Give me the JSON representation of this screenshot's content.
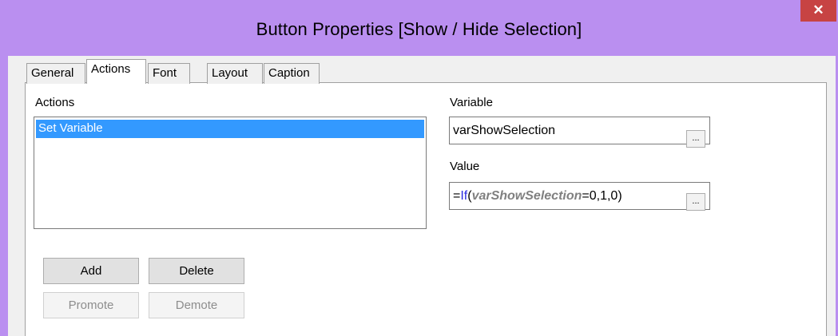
{
  "window": {
    "title": "Button Properties [Show / Hide Selection]",
    "close_glyph": "✕"
  },
  "tabs": [
    {
      "label": "General",
      "active": false
    },
    {
      "label": "Actions",
      "active": true
    },
    {
      "label": "Font",
      "active": false
    },
    {
      "label": "Layout",
      "active": false
    },
    {
      "label": "Caption",
      "active": false
    }
  ],
  "actions": {
    "label": "Actions",
    "items": [
      "Set Variable"
    ],
    "selected": "Set Variable"
  },
  "variable": {
    "label": "Variable",
    "value": "varShowSelection",
    "browse_label": "..."
  },
  "value": {
    "label": "Value",
    "expr_prefix": "=",
    "expr_function": "If",
    "expr_open": "(",
    "expr_variable": "varShowSelection",
    "expr_rest": "=0,1,0)",
    "browse_label": "..."
  },
  "buttons": {
    "add": "Add",
    "delete": "Delete",
    "promote": "Promote",
    "demote": "Demote"
  },
  "colors": {
    "frame": "#ba8ff0",
    "close": "#c74343",
    "selection": "#3399ff",
    "function_text": "#2a2ae0",
    "variable_text": "#808080"
  }
}
